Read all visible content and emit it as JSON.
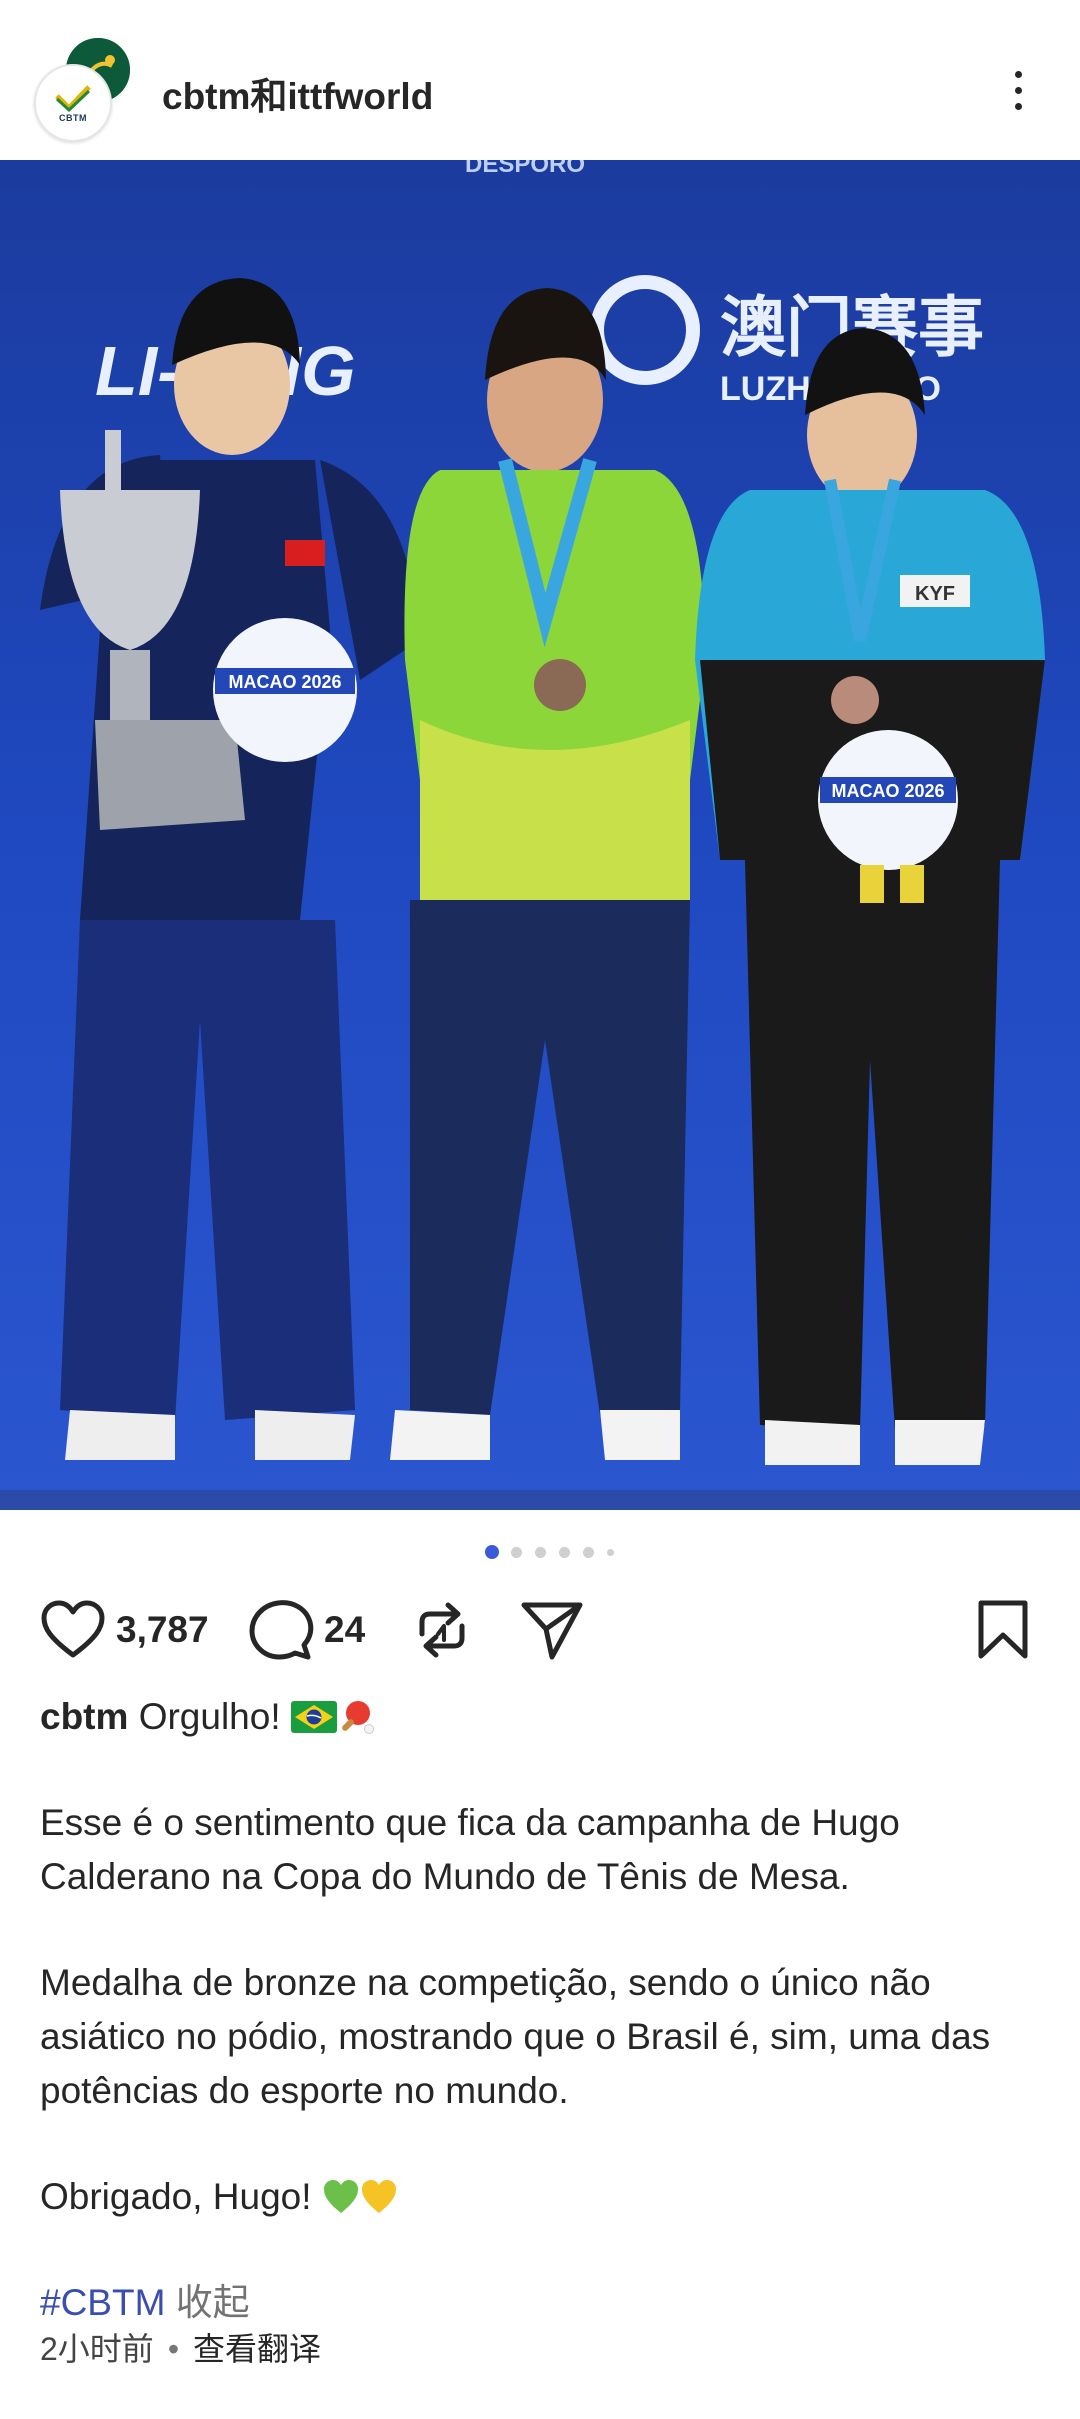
{
  "header": {
    "username": "cbtm和ittfworld",
    "avatar_text": "CBTM"
  },
  "photo": {
    "banner_top": "DESPORO",
    "brand_left": "LI-NING",
    "brand_right_cn": "澳门赛事",
    "brand_right_en": "LUZHOUJIAO",
    "mascot_label": "MACAO 2026",
    "sponsor_label": "KYF"
  },
  "carousel": {
    "active_index": 0,
    "total_visible": 6
  },
  "actions": {
    "likes": "3,787",
    "comments": "24"
  },
  "caption": {
    "username": "cbtm",
    "first_line": "Orgulho!",
    "paragraph_1": "Esse é o sentimento que fica da campanha de Hugo Calderano na Copa do Mundo de Tênis de Mesa.",
    "paragraph_2": "Medalha de bronze na competição, sendo o único não asiático no pódio, mostrando que o Brasil é, sim, uma das potências do esporte no mundo.",
    "paragraph_3": "Obrigado, Hugo!",
    "hashtag": "#CBTM",
    "collapse": "收起"
  },
  "meta": {
    "time": "2小时前",
    "translate": "查看翻译"
  },
  "colors": {
    "hashtag": "#3a4db0",
    "dot_active": "#3b5bdb",
    "photo_bg": "#1a3fa8"
  },
  "icons": [
    "more-icon",
    "heart-icon",
    "comment-icon",
    "repost-icon",
    "send-icon",
    "bookmark-icon",
    "brazil-flag-icon",
    "ping-pong-icon",
    "green-heart-icon",
    "yellow-heart-icon"
  ]
}
